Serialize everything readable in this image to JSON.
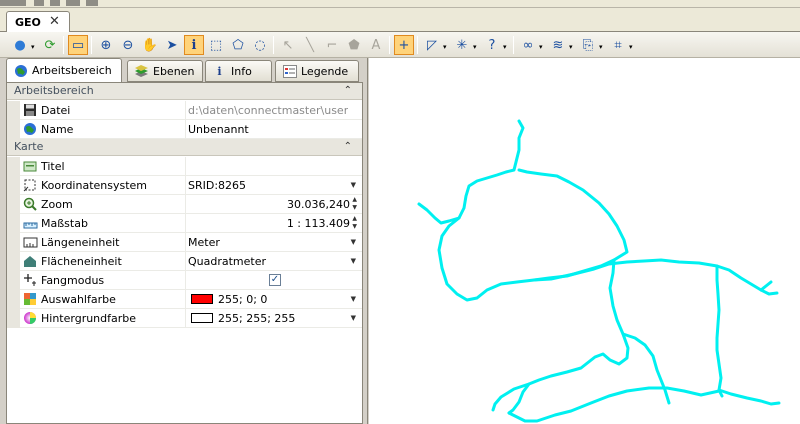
{
  "window": {
    "document_tab": "GEO",
    "close_glyph": "✕"
  },
  "toolbar": {
    "tools": [
      {
        "name": "globe-icon",
        "glyph": "●",
        "active": false,
        "enabled": true,
        "dropdown": true
      },
      {
        "name": "refresh-icon",
        "glyph": "⟳",
        "active": false,
        "enabled": true,
        "dropdown": false
      },
      {
        "name": "window-icon",
        "glyph": "▭",
        "active": true,
        "enabled": true,
        "dropdown": false
      },
      {
        "name": "zoom-in-icon",
        "glyph": "⊕",
        "active": false,
        "enabled": true,
        "dropdown": false
      },
      {
        "name": "zoom-out-icon",
        "glyph": "⊖",
        "active": false,
        "enabled": true,
        "dropdown": false
      },
      {
        "name": "pan-hand-icon",
        "glyph": "✋",
        "active": false,
        "enabled": true,
        "dropdown": false
      },
      {
        "name": "select-arrow-icon",
        "glyph": "➤",
        "active": false,
        "enabled": true,
        "dropdown": false
      },
      {
        "name": "info-icon",
        "glyph": "i",
        "active": true,
        "enabled": true,
        "dropdown": false
      },
      {
        "name": "rect-select-icon",
        "glyph": "⬚",
        "active": false,
        "enabled": true,
        "dropdown": false
      },
      {
        "name": "polygon-select-icon",
        "glyph": "⬠",
        "active": false,
        "enabled": true,
        "dropdown": false
      },
      {
        "name": "circle-select-icon",
        "glyph": "◌",
        "active": false,
        "enabled": true,
        "dropdown": false
      },
      {
        "name": "edit-pointer-icon",
        "glyph": "↖",
        "active": false,
        "enabled": false,
        "dropdown": false
      },
      {
        "name": "draw-line-icon",
        "glyph": "╲",
        "active": false,
        "enabled": false,
        "dropdown": false
      },
      {
        "name": "draw-polyline-icon",
        "glyph": "⌐",
        "active": false,
        "enabled": false,
        "dropdown": false
      },
      {
        "name": "draw-polygon-icon",
        "glyph": "⬟",
        "active": false,
        "enabled": false,
        "dropdown": false
      },
      {
        "name": "draw-text-icon",
        "glyph": "A",
        "active": false,
        "enabled": false,
        "dropdown": false
      },
      {
        "name": "snap-icon",
        "glyph": "+",
        "active": true,
        "enabled": true,
        "dropdown": false
      },
      {
        "name": "measure-icon",
        "glyph": "◸",
        "active": false,
        "enabled": true,
        "dropdown": true
      },
      {
        "name": "crosshair-icon",
        "glyph": "✳",
        "active": false,
        "enabled": true,
        "dropdown": true
      },
      {
        "name": "question-arrow-icon",
        "glyph": "?",
        "active": false,
        "enabled": true,
        "dropdown": true
      },
      {
        "name": "binoculars-icon",
        "glyph": "∞",
        "active": false,
        "enabled": true,
        "dropdown": true
      },
      {
        "name": "layers-icon",
        "glyph": "≋",
        "active": false,
        "enabled": true,
        "dropdown": true
      },
      {
        "name": "export-icon",
        "glyph": "⎘",
        "active": false,
        "enabled": true,
        "dropdown": true
      },
      {
        "name": "print-settings-icon",
        "glyph": "⌗",
        "active": false,
        "enabled": true,
        "dropdown": true
      }
    ]
  },
  "panel": {
    "tabs": [
      {
        "label": "Arbeitsbereich",
        "icon": "globe-icon",
        "selected": true
      },
      {
        "label": "Ebenen",
        "icon": "layers-icon",
        "selected": false
      },
      {
        "label": "Info",
        "icon": "info-icon",
        "selected": false
      },
      {
        "label": "Legende",
        "icon": "legend-icon",
        "selected": false
      }
    ]
  },
  "properties": {
    "arbeitsbereich": {
      "label": "Arbeitsbereich",
      "collapse_glyph": "⌃",
      "rows": [
        {
          "name": "Datei",
          "value": "d:\\daten\\connectmaster\\userme...",
          "icon": "save-disk-icon"
        },
        {
          "name": "Name",
          "value": "Unbenannt",
          "icon": "globe-icon"
        }
      ]
    },
    "karte": {
      "label": "Karte",
      "collapse_glyph": "⌃",
      "rows": [
        {
          "name": "Titel",
          "value": "",
          "icon": "title-icon",
          "control": "none"
        },
        {
          "name": "Koordinatensystem",
          "value": "SRID:8265",
          "icon": "coordinate-icon",
          "control": "dropdown"
        },
        {
          "name": "Zoom",
          "value": "30.036,240",
          "icon": "zoom-icon",
          "control": "spin"
        },
        {
          "name": "Maßstab",
          "value": "1 : 113.409",
          "icon": "scale-icon",
          "control": "spin"
        },
        {
          "name": "Längeneinheit",
          "value": "Meter",
          "icon": "ruler-icon",
          "control": "dropdown"
        },
        {
          "name": "Flächeneinheit",
          "value": "Quadratmeter",
          "icon": "area-icon",
          "control": "dropdown"
        },
        {
          "name": "Fangmodus",
          "value": "",
          "icon": "snap-mode-icon",
          "control": "checkbox",
          "checked": true
        },
        {
          "name": "Auswahlfarbe",
          "value": "255; 0; 0",
          "icon": "selection-color-icon",
          "control": "dropdown",
          "swatch": "#ff0000"
        },
        {
          "name": "Hintergrundfarbe",
          "value": "255; 255; 255",
          "icon": "background-color-icon",
          "control": "dropdown",
          "swatch": "#ffffff"
        }
      ]
    }
  },
  "map": {
    "background": "#ffffff",
    "line_color": "#00f0f0"
  },
  "colors": {
    "active_tool": "#ffd37a",
    "category_bg": "#e8e6de",
    "chrome": "#d4d0c8"
  }
}
